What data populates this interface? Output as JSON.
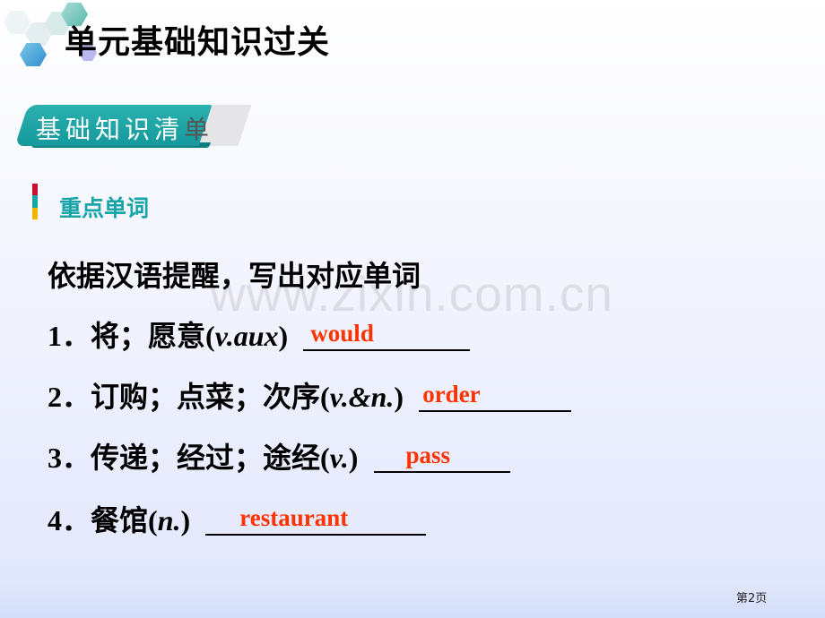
{
  "header": {
    "title": "单元基础知识过关"
  },
  "banner": {
    "text_main": "基础知识清",
    "text_last": "单"
  },
  "section": {
    "label": "重点单词",
    "bar_colors": [
      "#c8102e",
      "#18a5a8",
      "#f2b500"
    ]
  },
  "instruction": "依据汉语提醒，写出对应单词",
  "items": [
    {
      "num": "1．",
      "chinese": "将；愿意",
      "pos_open": "(",
      "pos": "v.aux",
      "pos_close": ")",
      "answer": "would"
    },
    {
      "num": "2．",
      "chinese": "订购；点菜；次序",
      "pos_open": "(",
      "pos": "v.&n.",
      "pos_close": ")",
      "answer": "order"
    },
    {
      "num": "3．",
      "chinese": "传递；经过；途经",
      "pos_open": "(",
      "pos": "v.",
      "pos_close": ")",
      "answer": "pass"
    },
    {
      "num": "4．",
      "chinese": "餐馆",
      "pos_open": "(",
      "pos": "n.",
      "pos_close": ")",
      "answer": "restaurant"
    }
  ],
  "watermark": "www.zixin.com.cn",
  "footer": {
    "page": "第2页"
  },
  "colors": {
    "accent_teal": "#18a5a8",
    "answer_red": "#ff3300"
  }
}
